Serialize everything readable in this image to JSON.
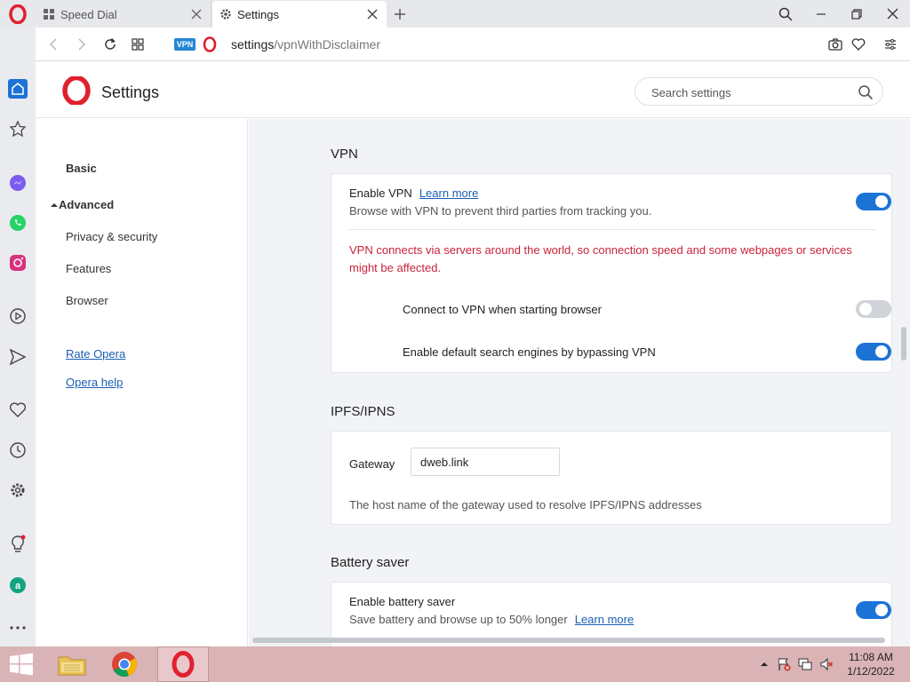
{
  "tabs": [
    {
      "label": "Speed Dial"
    },
    {
      "label": "Settings"
    }
  ],
  "address": {
    "vpn_badge": "VPN",
    "host": "settings",
    "path": "/vpnWithDisclaimer"
  },
  "header": {
    "title": "Settings",
    "search_placeholder": "Search settings"
  },
  "nav": {
    "basic": "Basic",
    "advanced": "Advanced",
    "items": [
      "Privacy & security",
      "Features",
      "Browser"
    ],
    "links": [
      "Rate Opera",
      "Opera help"
    ]
  },
  "vpn": {
    "section_title": "VPN",
    "enable_label": "Enable VPN",
    "learn_more": "Learn more",
    "enable_desc": "Browse with VPN to prevent third parties from tracking you.",
    "warning": "VPN connects via servers around the world, so connection speed and some webpages or services might be affected.",
    "connect_on_start_label": "Connect to VPN when starting browser",
    "bypass_label": "Enable default search engines by bypassing VPN",
    "enable_on": true,
    "connect_on_start_on": false,
    "bypass_on": true
  },
  "ipfs": {
    "section_title": "IPFS/IPNS",
    "gateway_label": "Gateway",
    "gateway_value": "dweb.link",
    "gateway_desc": "The host name of the gateway used to resolve IPFS/IPNS addresses"
  },
  "battery": {
    "section_title": "Battery saver",
    "enable_label": "Enable battery saver",
    "desc": "Save battery and browse up to 50% longer",
    "learn_more": "Learn more",
    "enable_on": true
  },
  "taskbar": {
    "time": "11:08 AM",
    "date": "1/12/2022"
  },
  "colors": {
    "accent": "#1c73d6",
    "warning": "#c8233a",
    "opera_red": "#e0202e",
    "taskbar": "#d9b3b5"
  }
}
